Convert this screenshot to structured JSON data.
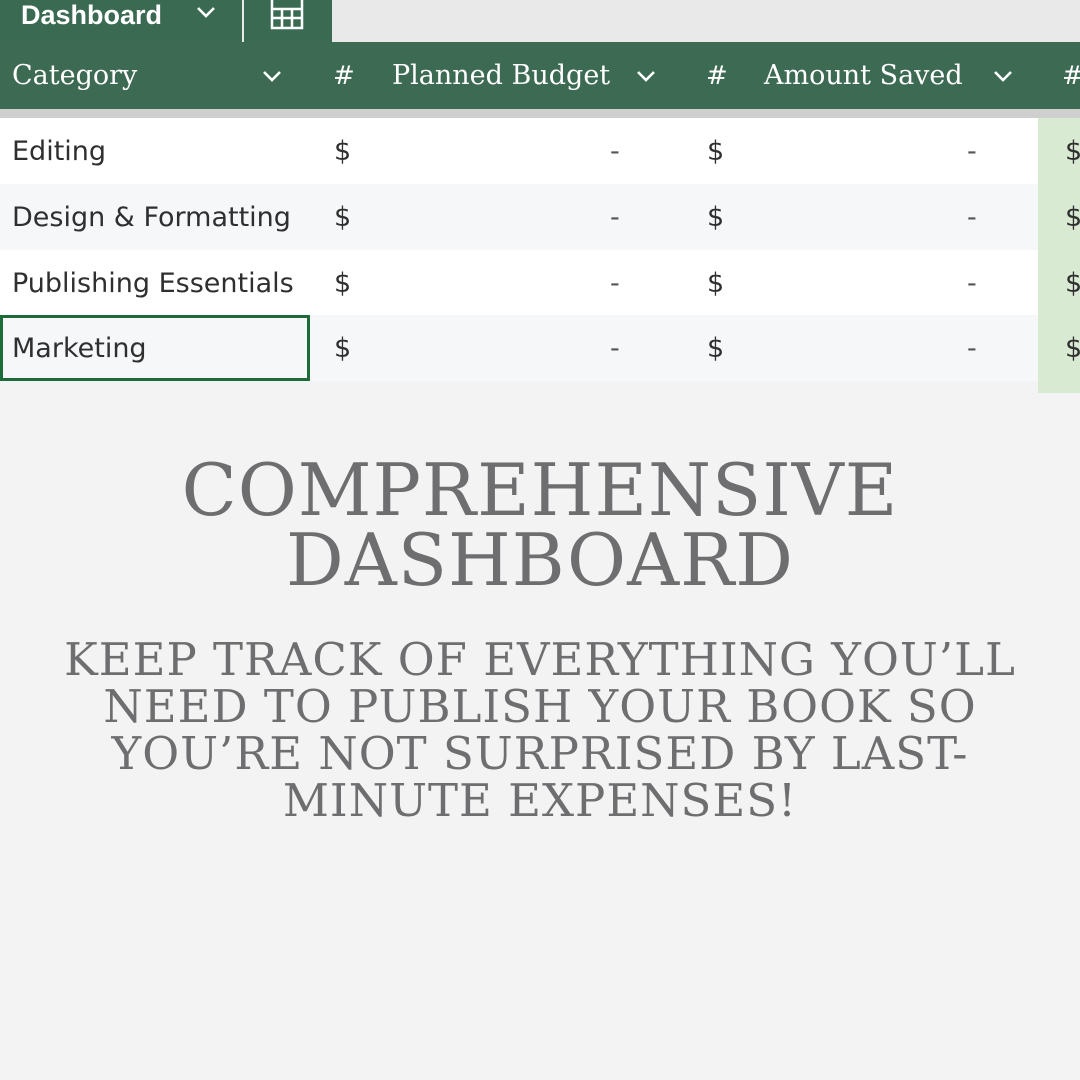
{
  "tabs": {
    "active_label": "Dashboard",
    "sheet_icon": "spreadsheet-icon"
  },
  "table": {
    "columns": [
      {
        "label": "Category"
      },
      {
        "label": "#"
      },
      {
        "label": "Planned Budget"
      },
      {
        "label": "#"
      },
      {
        "label": "Amount Saved"
      },
      {
        "label": "#"
      }
    ],
    "rows": [
      {
        "category": "Editing",
        "planned_currency": "$",
        "planned_value": "-",
        "saved_currency": "$",
        "saved_value": "-",
        "extra_currency": "$"
      },
      {
        "category": "Design & Formatting",
        "planned_currency": "$",
        "planned_value": "-",
        "saved_currency": "$",
        "saved_value": "-",
        "extra_currency": "$"
      },
      {
        "category": "Publishing Essentials",
        "planned_currency": "$",
        "planned_value": "-",
        "saved_currency": "$",
        "saved_value": "-",
        "extra_currency": "$"
      },
      {
        "category": "Marketing",
        "planned_currency": "$",
        "planned_value": "-",
        "saved_currency": "$",
        "saved_value": "-",
        "extra_currency": "$"
      }
    ]
  },
  "promo": {
    "headline_line1": "COMPREHENSIVE",
    "headline_line2": "DASHBOARD",
    "sub_line1": "KEEP TRACK OF EVERYTHING YOU’LL",
    "sub_line2": "NEED TO PUBLISH YOUR BOOK SO",
    "sub_line3": "YOU’RE NOT SURPRISED BY LAST-",
    "sub_line4": "MINUTE EXPENSES!"
  },
  "colors": {
    "header_green": "#3d6a52",
    "selection_green": "#1e6b3a",
    "highlight_column": "#d9ead3",
    "promo_text": "#6e6e70"
  }
}
